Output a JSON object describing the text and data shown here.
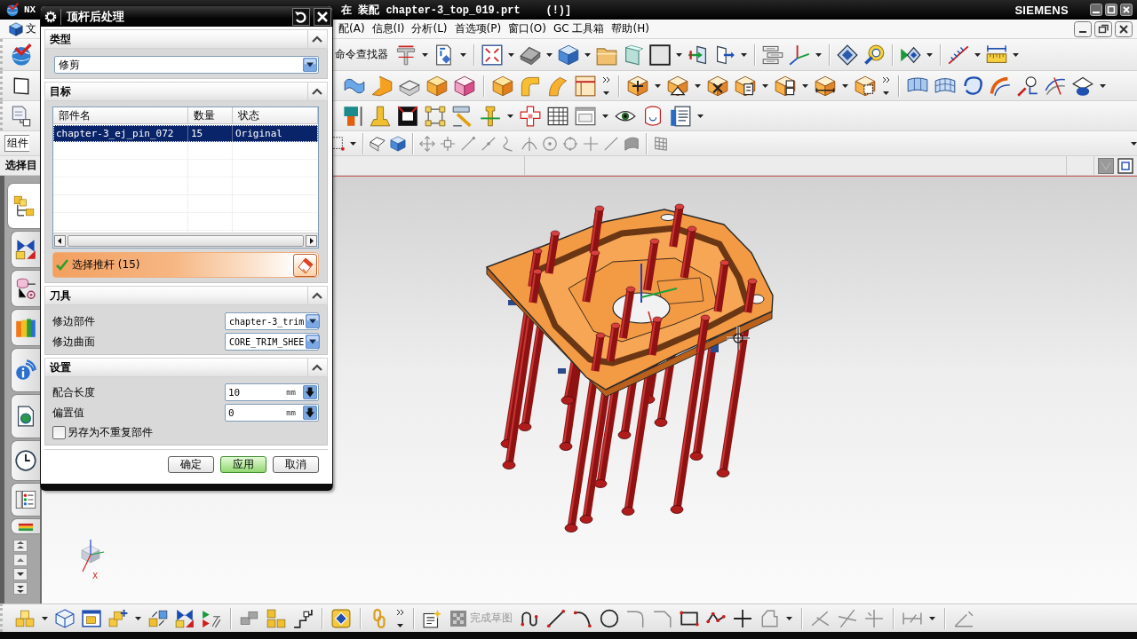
{
  "title_bar": {
    "app": "NX",
    "document": "在 装配 chapter-3_top_019.prt    (!)]",
    "brand": "SIEMENS"
  },
  "menu_bar": {
    "items": [
      {
        "label": "文"
      },
      {
        "label": "配(A)"
      },
      {
        "label": "信息(I)"
      },
      {
        "label": "分析(L)"
      },
      {
        "label": "首选项(P)"
      },
      {
        "label": "窗口(O)"
      },
      {
        "label": "GC 工具箱"
      },
      {
        "label": "帮助(H)"
      }
    ]
  },
  "toolbar": {
    "command_finder": "命令查找器"
  },
  "selection_bar": {
    "filter": "组件"
  },
  "prompt": "选择目",
  "resource_bar": {
    "tabs": [
      {
        "selected": true
      },
      {
        "selected": false
      },
      {
        "selected": false
      },
      {
        "selected": false
      },
      {
        "selected": false
      },
      {
        "selected": false
      },
      {
        "selected": false
      },
      {
        "selected": false
      },
      {
        "selected": false
      }
    ]
  },
  "dialog": {
    "title": "顶杆后处理",
    "sections": [
      {
        "kind": "type",
        "title": "类型",
        "expanded": true,
        "value": "修剪"
      },
      {
        "kind": "target",
        "title": "目标",
        "expanded": true,
        "table": {
          "columns": [
            "部件名",
            "数量",
            "状态"
          ],
          "rows": [
            {
              "cells": [
                "chapter-3_ej_pin_072",
                "15",
                "Original"
              ],
              "selected": true
            }
          ]
        },
        "selector": {
          "label": "选择推杆 (15)",
          "done": true
        }
      },
      {
        "kind": "tool",
        "title": "刀具",
        "expanded": true,
        "fields": [
          {
            "label": "修边部件",
            "value": "chapter-3_trim"
          },
          {
            "label": "修边曲面",
            "value": "CORE_TRIM_SHEE"
          }
        ]
      },
      {
        "kind": "settings",
        "title": "设置",
        "expanded": true,
        "fields": [
          {
            "label": "配合长度",
            "value": "10",
            "unit": "mm"
          },
          {
            "label": "偏置值",
            "value": "0",
            "unit": "mm"
          }
        ],
        "checkbox": {
          "label": "另存为不重复部件",
          "checked": false
        }
      }
    ],
    "buttons": [
      {
        "label": "确定",
        "default": false
      },
      {
        "label": "应用",
        "default": true
      },
      {
        "label": "取消",
        "default": false
      }
    ]
  },
  "viewport": {
    "triad_label": "X"
  },
  "bottom_toolbar": {
    "finish_sketch": {
      "label": "完成草图",
      "disabled": true
    }
  }
}
